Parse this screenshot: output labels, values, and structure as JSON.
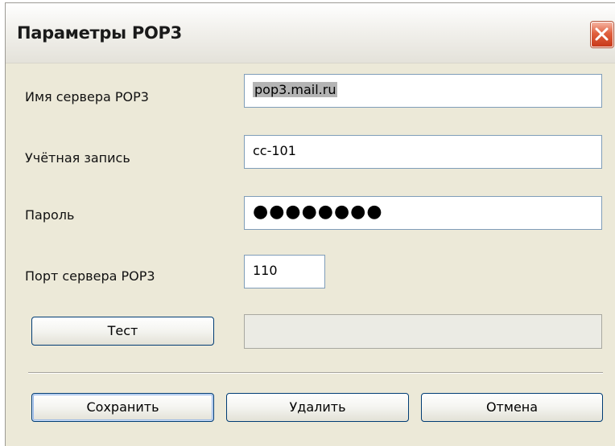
{
  "window": {
    "title": "Параметры POP3"
  },
  "form": {
    "server_label": "Имя сервера POP3",
    "server_value": "pop3.mail.ru",
    "account_label": "Учётная запись",
    "account_value": "cc-101",
    "password_label": "Пароль",
    "password_value": "●●●●●●●●",
    "port_label": "Порт сервера POP3",
    "port_value": "110",
    "test_result": ""
  },
  "buttons": {
    "test": "Тест",
    "save": "Сохранить",
    "delete": "Удалить",
    "cancel": "Отмена"
  },
  "icons": {
    "close": "close-icon"
  },
  "colors": {
    "dialog_bg": "#ece9d8",
    "field_border": "#7f9db9",
    "button_border": "#003c74",
    "close_red": "#e0603e"
  }
}
